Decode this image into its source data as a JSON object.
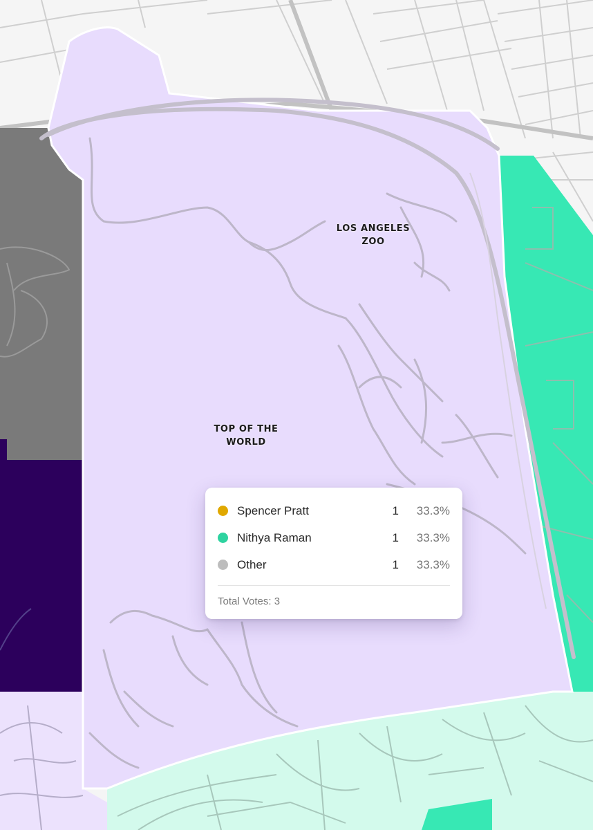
{
  "map": {
    "labels": {
      "zoo": [
        "LOS ANGELES",
        "ZOO"
      ],
      "top_of_world": [
        "TOP OF THE",
        "WORLD"
      ]
    },
    "colors": {
      "lavender_precinct": "#e8dcfd",
      "raman_strong": "#37e8b4",
      "raman_light": "#d3faec",
      "gray_precinct": "#7a7a7a",
      "dark_purple_precinct": "#2c005c",
      "roads": "#aaaaaa"
    }
  },
  "tooltip": {
    "candidates": [
      {
        "name": "Spencer Pratt",
        "votes": "1",
        "pct": "33.3%",
        "color": "#e0a800"
      },
      {
        "name": "Nithya Raman",
        "votes": "1",
        "pct": "33.3%",
        "color": "#2ed3a0"
      },
      {
        "name": "Other",
        "votes": "1",
        "pct": "33.3%",
        "color": "#bdbdbd"
      }
    ],
    "total": "Total Votes: 3"
  }
}
